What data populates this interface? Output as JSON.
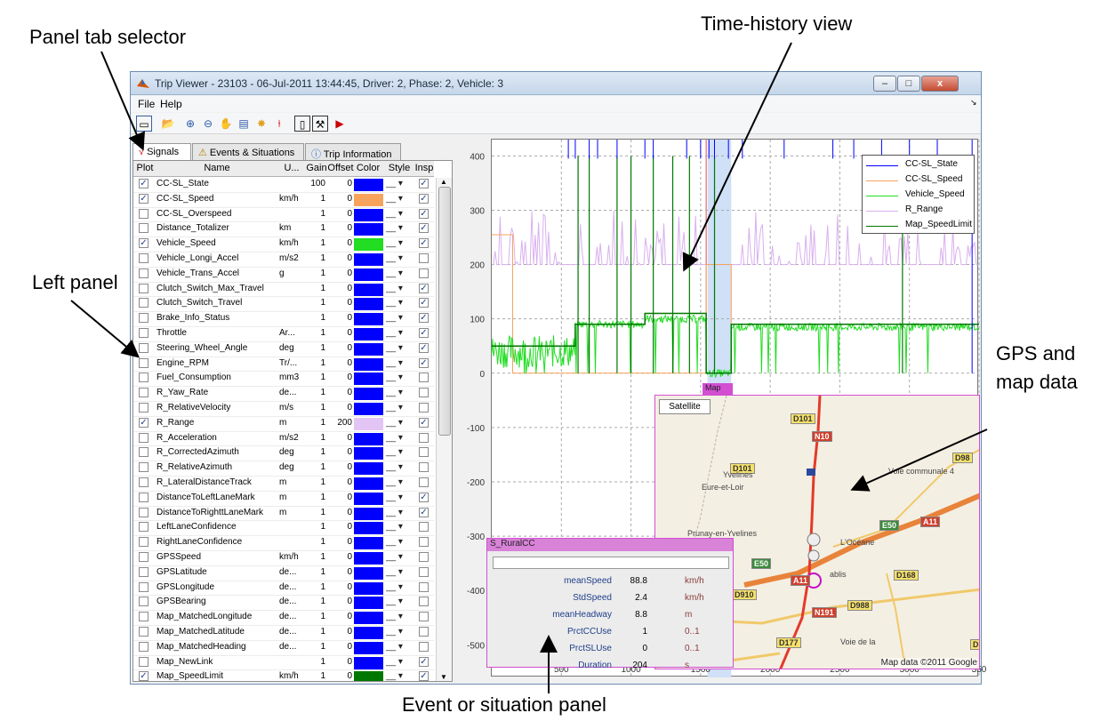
{
  "annotations": {
    "panel_tab": "Panel tab selector",
    "time_history": "Time-history view",
    "left_panel": "Left panel",
    "gps1": "GPS and",
    "gps2": "map data",
    "event": "Event or situation panel"
  },
  "window": {
    "title": "Trip Viewer - 23103 - 06-Jul-2011 13:44:45, Driver: 2, Phase: 2, Vehicle: 3",
    "min": "–",
    "max": "□",
    "close": "x"
  },
  "menu": {
    "file": "File",
    "help": "Help"
  },
  "tabs": {
    "signals": "Signals",
    "events": "Events & Situations",
    "trip": "Trip Information"
  },
  "columns": {
    "plot": "Plot",
    "name": "Name",
    "unit": "U...",
    "gain": "Gain",
    "offset": "Offset",
    "color": "Color",
    "style": "Style",
    "insp": "Insp"
  },
  "rows": [
    {
      "name": "CC-SL_State",
      "unit": "",
      "gain": "100",
      "offset": "0",
      "color": "#0000ff",
      "plot": true,
      "insp": true
    },
    {
      "name": "CC-SL_Speed",
      "unit": "km/h",
      "gain": "1",
      "offset": "0",
      "color": "#f7a35c",
      "plot": true,
      "insp": true
    },
    {
      "name": "CC-SL_Overspeed",
      "unit": "",
      "gain": "1",
      "offset": "0",
      "color": "#0000ff",
      "plot": false,
      "insp": true
    },
    {
      "name": "Distance_Totalizer",
      "unit": "km",
      "gain": "1",
      "offset": "0",
      "color": "#0000ff",
      "plot": false,
      "insp": true
    },
    {
      "name": "Vehicle_Speed",
      "unit": "km/h",
      "gain": "1",
      "offset": "0",
      "color": "#22dd22",
      "plot": true,
      "insp": true
    },
    {
      "name": "Vehicle_Longi_Accel",
      "unit": "m/s2",
      "gain": "1",
      "offset": "0",
      "color": "#0000ff",
      "plot": false,
      "insp": false
    },
    {
      "name": "Vehicle_Trans_Accel",
      "unit": "g",
      "gain": "1",
      "offset": "0",
      "color": "#0000ff",
      "plot": false,
      "insp": false
    },
    {
      "name": "Clutch_Switch_Max_Travel",
      "unit": "",
      "gain": "1",
      "offset": "0",
      "color": "#0000ff",
      "plot": false,
      "insp": true
    },
    {
      "name": "Clutch_Switch_Travel",
      "unit": "",
      "gain": "1",
      "offset": "0",
      "color": "#0000ff",
      "plot": false,
      "insp": true
    },
    {
      "name": "Brake_Info_Status",
      "unit": "",
      "gain": "1",
      "offset": "0",
      "color": "#0000ff",
      "plot": false,
      "insp": true
    },
    {
      "name": "Throttle",
      "unit": "Ar...",
      "gain": "1",
      "offset": "0",
      "color": "#0000ff",
      "plot": false,
      "insp": true
    },
    {
      "name": "Steering_Wheel_Angle",
      "unit": "deg",
      "gain": "1",
      "offset": "0",
      "color": "#0000ff",
      "plot": false,
      "insp": true
    },
    {
      "name": "Engine_RPM",
      "unit": "Tr/...",
      "gain": "1",
      "offset": "0",
      "color": "#0000ff",
      "plot": false,
      "insp": true
    },
    {
      "name": "Fuel_Consumption",
      "unit": "mm3",
      "gain": "1",
      "offset": "0",
      "color": "#0000ff",
      "plot": false,
      "insp": false
    },
    {
      "name": "R_Yaw_Rate",
      "unit": "de...",
      "gain": "1",
      "offset": "0",
      "color": "#0000ff",
      "plot": false,
      "insp": false
    },
    {
      "name": "R_RelativeVelocity",
      "unit": "m/s",
      "gain": "1",
      "offset": "0",
      "color": "#0000ff",
      "plot": false,
      "insp": false
    },
    {
      "name": "R_Range",
      "unit": "m",
      "gain": "1",
      "offset": "200",
      "color": "#e3c5f5",
      "plot": true,
      "insp": true
    },
    {
      "name": "R_Acceleration",
      "unit": "m/s2",
      "gain": "1",
      "offset": "0",
      "color": "#0000ff",
      "plot": false,
      "insp": false
    },
    {
      "name": "R_CorrectedAzimuth",
      "unit": "deg",
      "gain": "1",
      "offset": "0",
      "color": "#0000ff",
      "plot": false,
      "insp": false
    },
    {
      "name": "R_RelativeAzimuth",
      "unit": "deg",
      "gain": "1",
      "offset": "0",
      "color": "#0000ff",
      "plot": false,
      "insp": false
    },
    {
      "name": "R_LateralDistanceTrack",
      "unit": "m",
      "gain": "1",
      "offset": "0",
      "color": "#0000ff",
      "plot": false,
      "insp": false
    },
    {
      "name": "DistanceToLeftLaneMark",
      "unit": "m",
      "gain": "1",
      "offset": "0",
      "color": "#0000ff",
      "plot": false,
      "insp": true
    },
    {
      "name": "DistanceToRighttLaneMark",
      "unit": "m",
      "gain": "1",
      "offset": "0",
      "color": "#0000ff",
      "plot": false,
      "insp": true
    },
    {
      "name": "LeftLaneConfidence",
      "unit": "",
      "gain": "1",
      "offset": "0",
      "color": "#0000ff",
      "plot": false,
      "insp": false
    },
    {
      "name": "RightLaneConfidence",
      "unit": "",
      "gain": "1",
      "offset": "0",
      "color": "#0000ff",
      "plot": false,
      "insp": false
    },
    {
      "name": "GPSSpeed",
      "unit": "km/h",
      "gain": "1",
      "offset": "0",
      "color": "#0000ff",
      "plot": false,
      "insp": false
    },
    {
      "name": "GPSLatitude",
      "unit": "de...",
      "gain": "1",
      "offset": "0",
      "color": "#0000ff",
      "plot": false,
      "insp": false
    },
    {
      "name": "GPSLongitude",
      "unit": "de...",
      "gain": "1",
      "offset": "0",
      "color": "#0000ff",
      "plot": false,
      "insp": false
    },
    {
      "name": "GPSBearing",
      "unit": "de...",
      "gain": "1",
      "offset": "0",
      "color": "#0000ff",
      "plot": false,
      "insp": false
    },
    {
      "name": "Map_MatchedLongitude",
      "unit": "de...",
      "gain": "1",
      "offset": "0",
      "color": "#0000ff",
      "plot": false,
      "insp": false
    },
    {
      "name": "Map_MatchedLatitude",
      "unit": "de...",
      "gain": "1",
      "offset": "0",
      "color": "#0000ff",
      "plot": false,
      "insp": false
    },
    {
      "name": "Map_MatchedHeading",
      "unit": "de...",
      "gain": "1",
      "offset": "0",
      "color": "#0000ff",
      "plot": false,
      "insp": false
    },
    {
      "name": "Map_NewLink",
      "unit": "",
      "gain": "1",
      "offset": "0",
      "color": "#0000ff",
      "plot": false,
      "insp": true
    },
    {
      "name": "Map_SpeedLimit",
      "unit": "km/h",
      "gain": "1",
      "offset": "0",
      "color": "#007700",
      "plot": true,
      "insp": true
    }
  ],
  "chart_data": {
    "type": "line",
    "x_ticks": [
      "500",
      "1000",
      "1500",
      "2000",
      "2500",
      "3000",
      "350"
    ],
    "y_ticks": [
      "400",
      "300",
      "200",
      "100",
      "0",
      "-100",
      "-200",
      "-300",
      "-400",
      "-500"
    ],
    "xlim": [
      0,
      3500
    ],
    "ylim": [
      -560,
      430
    ],
    "series": [
      {
        "name": "CC-SL_State",
        "color": "#0000ff"
      },
      {
        "name": "CC-SL_Speed",
        "color": "#f7a35c"
      },
      {
        "name": "Vehicle_Speed",
        "color": "#22dd22"
      },
      {
        "name": "R_Range",
        "color": "#d9b0ee"
      },
      {
        "name": "Map_SpeedLimit",
        "color": "#007700"
      }
    ],
    "selection": [
      1550,
      1720
    ]
  },
  "map": {
    "title": "Map",
    "satellite": "Satellite",
    "credit": "Map data ©2011 Google",
    "labels": [
      "D101",
      "N10",
      "D101",
      "D98",
      "E50",
      "A11",
      "E50",
      "A11",
      "D168",
      "D910",
      "D988",
      "N191",
      "D177",
      "D1",
      "Prunay-en-Yvelines",
      "Eure-et-Loir",
      "Yvelines",
      "Voie communale 4",
      "L'Océane",
      "ablis",
      "Voie de la"
    ]
  },
  "event": {
    "title": "S_RuralCC",
    "rows": [
      {
        "k": "meanSpeed",
        "v": "88.8",
        "u": "km/h"
      },
      {
        "k": "StdSpeed",
        "v": "2.4",
        "u": "km/h"
      },
      {
        "k": "meanHeadway",
        "v": "8.8",
        "u": "m"
      },
      {
        "k": "PrctCCUse",
        "v": "1",
        "u": "0..1"
      },
      {
        "k": "PrctSLUse",
        "v": "0",
        "u": "0..1"
      },
      {
        "k": "Duration",
        "v": "204",
        "u": "s"
      }
    ]
  }
}
